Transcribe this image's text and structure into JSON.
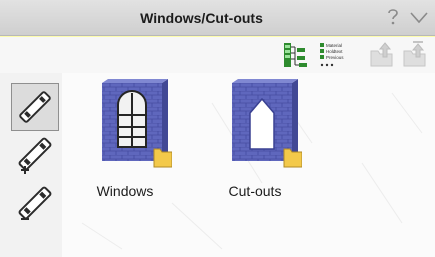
{
  "window": {
    "title": "Windows/Cut-outs"
  },
  "toolbar": {
    "legend_lines": [
      "Material",
      "Holdtext",
      "Previous"
    ]
  },
  "items": [
    {
      "label": "Windows"
    },
    {
      "label": "Cut-outs"
    }
  ],
  "colors": {
    "panel_background": "#fcfcac",
    "title_bar": "#d8d8d8",
    "wall_blue": "#5a62b8",
    "folder_yellow": "#f3c94a",
    "green_accent": "#2e8b2e"
  },
  "icons": {
    "help": "question-mark-icon",
    "collapse": "chevron-down-icon",
    "tree": "tree-view-icon",
    "nav_up": "folder-up-icon",
    "tools": [
      "select-tool-icon",
      "add-tool-icon",
      "remove-tool-icon"
    ]
  }
}
